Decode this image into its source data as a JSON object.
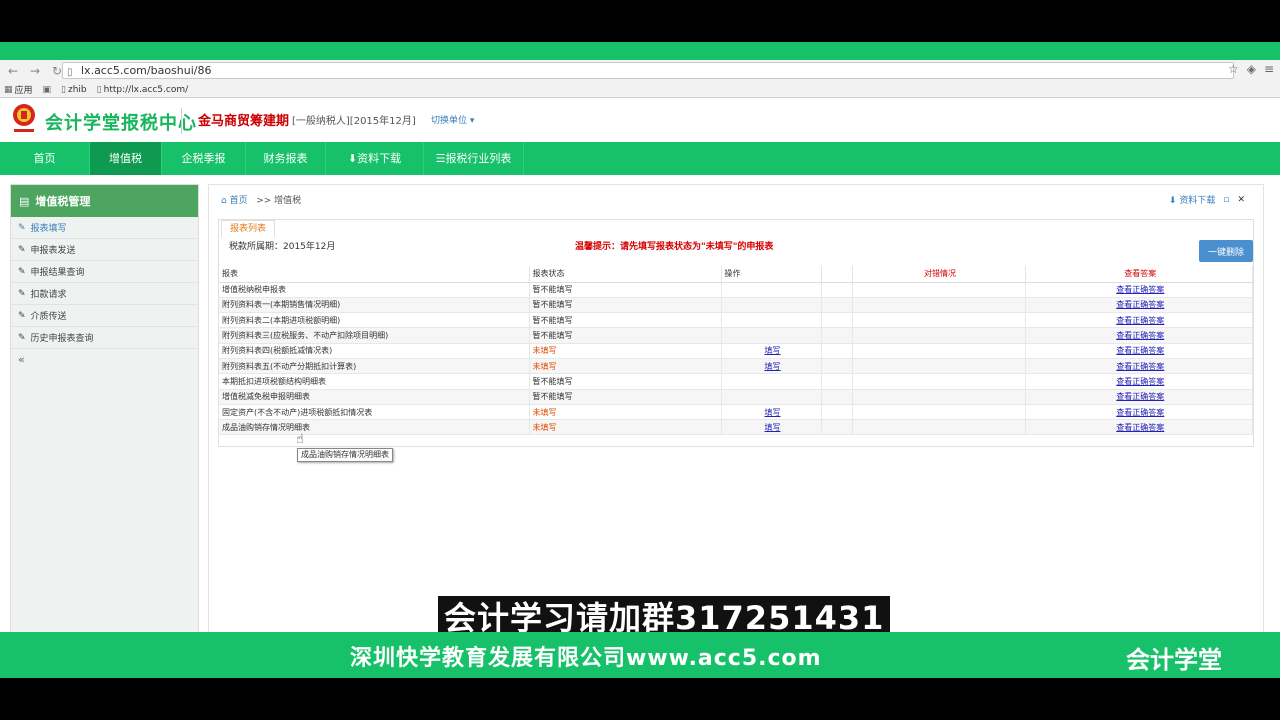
{
  "browser": {
    "url": "lx.acc5.com/baoshui/86",
    "bookmarks": [
      "应用",
      "zhib",
      "http://lx.acc5.com/"
    ]
  },
  "header": {
    "logo_text": "会计学堂报税中心",
    "company_name": "金马商贸筹建期",
    "company_type": "[一般纳税人][2015年12月]",
    "switch_unit": "切换单位 ▾"
  },
  "nav": {
    "items": [
      "首页",
      "增值税",
      "企税季报",
      "财务报表",
      "资料下载",
      "报税行业列表"
    ]
  },
  "sidebar": {
    "title": "增值税管理",
    "items": [
      "报表填写",
      "申报表发送",
      "申报结果查询",
      "扣款请求",
      "介质传送",
      "历史申报表查询"
    ],
    "collapse": "«"
  },
  "content": {
    "breadcrumb_home": "首页",
    "breadcrumb_current": ">> 增值税",
    "download_label": "资料下载",
    "tab_label": "报表列表",
    "period_label": "税款所属期：2015年12月",
    "tip": "温馨提示：请先填写报表状态为\"未填写\"的申报表",
    "delete_all": "一键删除",
    "columns": [
      "报表",
      "报表状态",
      "操作",
      "",
      "对错情况",
      "查看答案"
    ],
    "rows": [
      {
        "name": "增值税纳税申报表",
        "status": "暂不能填写",
        "action": "",
        "answer": "查看正确答案"
      },
      {
        "name": "附列资料表一(本期销售情况明细)",
        "status": "暂不能填写",
        "action": "",
        "answer": "查看正确答案"
      },
      {
        "name": "附列资料表二(本期进项税额明细)",
        "status": "暂不能填写",
        "action": "",
        "answer": "查看正确答案"
      },
      {
        "name": "附列资料表三(应税服务、不动产扣除项目明细)",
        "status": "暂不能填写",
        "action": "",
        "answer": "查看正确答案"
      },
      {
        "name": "附列资料表四(税额抵减情况表)",
        "status": "未填写",
        "action": "填写",
        "answer": "查看正确答案"
      },
      {
        "name": "附列资料表五(不动产分期抵扣计算表)",
        "status": "未填写",
        "action": "填写",
        "answer": "查看正确答案"
      },
      {
        "name": "本期抵扣进项税额结构明细表",
        "status": "暂不能填写",
        "action": "",
        "answer": "查看正确答案"
      },
      {
        "name": "增值税减免税申报明细表",
        "status": "暂不能填写",
        "action": "",
        "answer": "查看正确答案"
      },
      {
        "name": "固定资产(不含不动产)进项税额抵扣情况表",
        "status": "未填写",
        "action": "填写",
        "answer": "查看正确答案"
      },
      {
        "name": "成品油购销存情况明细表",
        "status": "未填写",
        "action": "填写",
        "answer": "查看正确答案"
      }
    ],
    "tooltip": "成品油购销存情况明细表"
  },
  "overlay": {
    "subtitle": "会计学习请加群317251431",
    "footer_company": "深圳快学教育发展有限公司www.acc5.com",
    "footer_brand": "会计学堂"
  },
  "colors": {
    "brand_green": "#17c16a",
    "active_nav": "#0f9a52",
    "alert_red": "#d60000",
    "status_orange": "#e04a00",
    "link_blue": "#2222bb"
  }
}
